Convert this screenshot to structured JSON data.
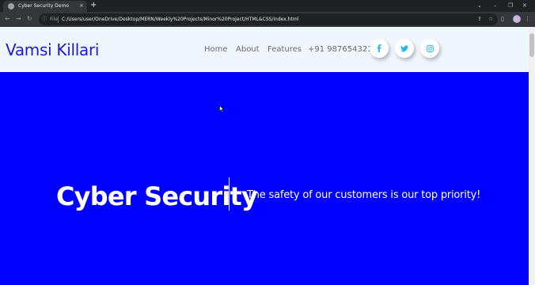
{
  "browser": {
    "tab_title": "Cyber Security Demo",
    "tab_close": "×",
    "new_tab": "+",
    "url_scheme": "File",
    "url": "C:/Users/user/OneDrive/Desktop/MERN/Weekly%20Projects/Minor%20Project/HTML&CSS/index.html",
    "icons": [
      "back-icon",
      "forward-icon",
      "reload-icon",
      "info-icon",
      "share-icon",
      "bookmark-star-icon",
      "side-panel-icon",
      "profile-avatar-icon",
      "menu-icon"
    ],
    "window_controls": [
      "minimize-icon",
      "maximize-icon",
      "close-icon"
    ]
  },
  "site": {
    "brand": "Vamsi Killari",
    "brand_color": "#1a1ad6",
    "nav": {
      "home": "Home",
      "about": "About",
      "features": "Features",
      "phone": "+91 9876543210"
    },
    "social": [
      "facebook-icon",
      "twitter-icon",
      "instagram-icon"
    ],
    "social_color": "#29b6f6"
  },
  "hero": {
    "title": "Cyber Security",
    "tagline": "The safety of our customers is our top priority!",
    "background": "#0000ff"
  }
}
